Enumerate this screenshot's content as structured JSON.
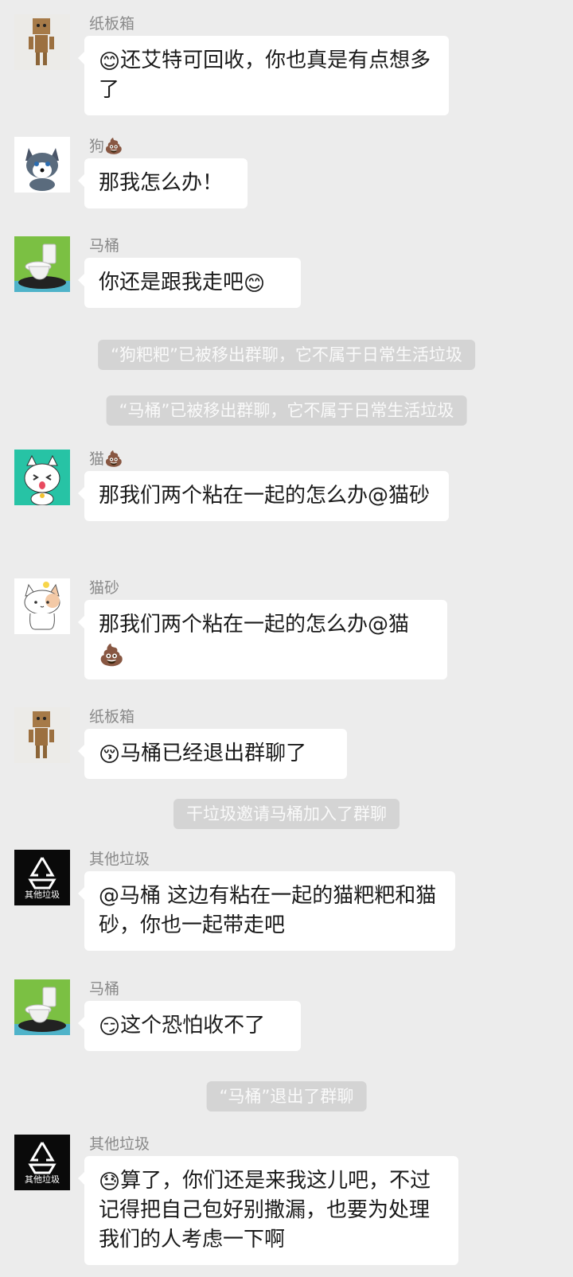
{
  "messages": [
    {
      "sender": "纸板箱",
      "emoji": "😊",
      "text": "还艾特可回收，你也真是有点想多了"
    },
    {
      "sender": "狗",
      "sender_emoji": "💩",
      "text": "那我怎么办！"
    },
    {
      "sender": "马桶",
      "text": "你还是跟我走吧",
      "trail_emoji": "😊"
    },
    {
      "sender": "猫",
      "sender_emoji": "💩",
      "text": "那我们两个粘在一起的怎么办@猫砂"
    },
    {
      "sender": "猫砂",
      "text": "那我们两个粘在一起的怎么办@猫",
      "trail_emoji": "💩"
    },
    {
      "sender": "纸板箱",
      "emoji": "😚",
      "text": "马桶已经退出群聊了"
    },
    {
      "sender": "其他垃圾",
      "text": "@马桶 这边有粘在一起的猫粑粑和猫砂，你也一起带走吧"
    },
    {
      "sender": "马桶",
      "emoji": "😏",
      "text": "这个恐怕收不了"
    },
    {
      "sender": "其他垃圾",
      "emoji": "😓",
      "text": "算了，你们还是来我这儿吧，不过记得把自己包好别撒漏，也要为处理我们的人考虑一下啊"
    }
  ],
  "system": [
    "“狗粑粑”已被移出群聊，它不属于日常生活垃圾",
    "“马桶”已被移出群聊，它不属于日常生活垃圾",
    "干垃圾邀请马桶加入了群聊",
    "“马桶”退出了群聊"
  ],
  "avatar_labels": {
    "other_trash": "其他垃圾"
  }
}
